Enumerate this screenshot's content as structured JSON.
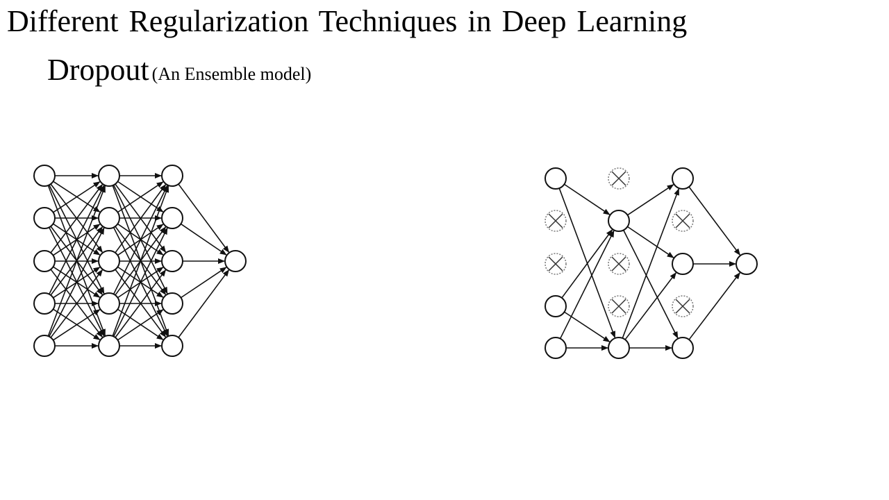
{
  "slide": {
    "title": "Different Regularization Techniques in Deep Learning",
    "subtitle": "Dropout",
    "subtitle_note": "(An Ensemble model)"
  },
  "colors": {
    "stroke": "#111111",
    "dropped_node": "#777777",
    "background": "#ffffff"
  },
  "diagrams": {
    "full_network": {
      "layer_sizes": [
        5,
        5,
        5,
        1
      ],
      "dropped": [
        [],
        [],
        [],
        []
      ]
    },
    "dropout_network": {
      "layer_sizes": [
        5,
        5,
        5,
        1
      ],
      "dropped": [
        [
          1,
          2
        ],
        [
          0,
          2,
          3
        ],
        [
          1,
          3
        ],
        []
      ]
    }
  }
}
